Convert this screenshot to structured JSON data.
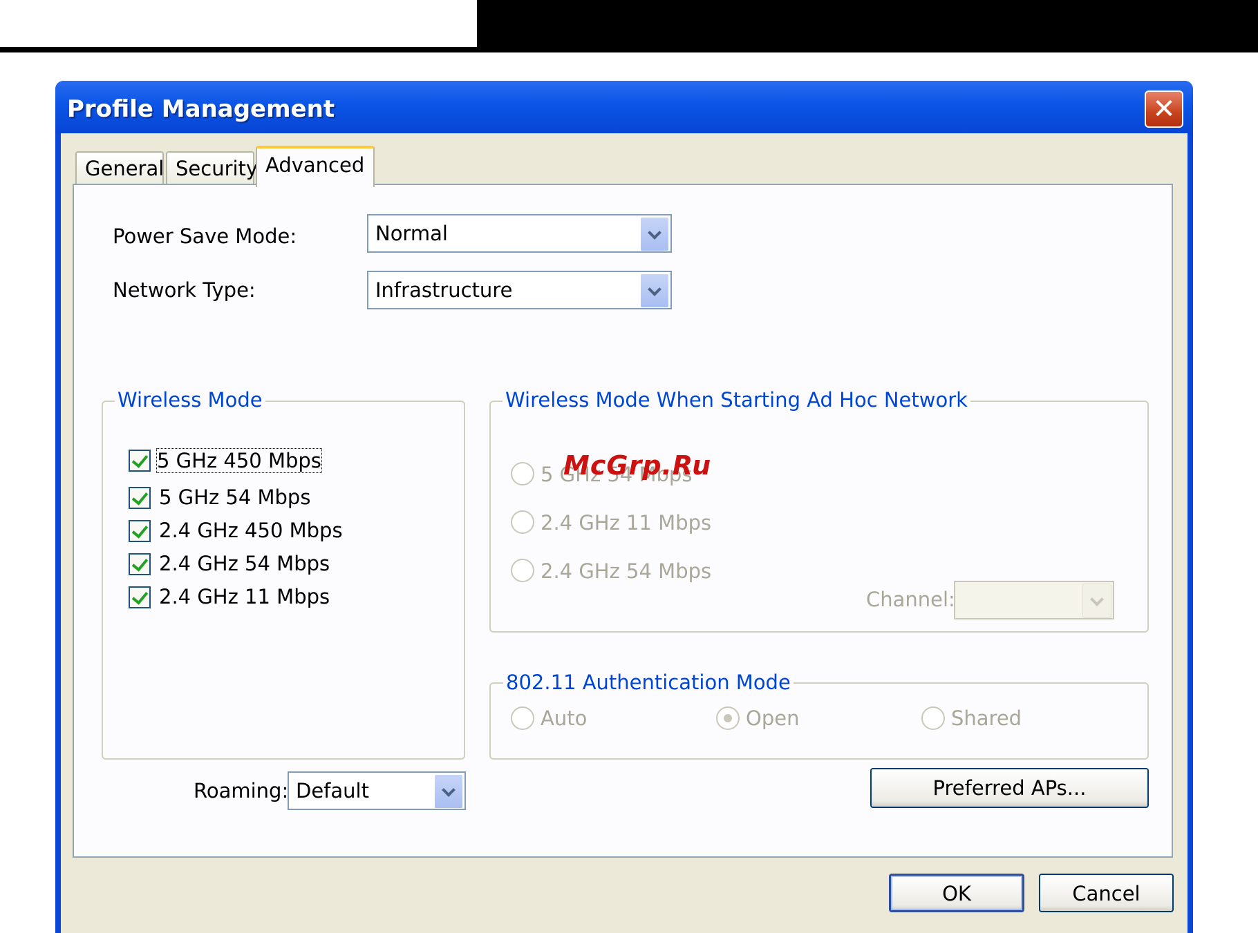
{
  "window": {
    "title": "Profile Management",
    "close_glyph": "✕"
  },
  "tabs": [
    {
      "label": "General",
      "active": false
    },
    {
      "label": "Security",
      "active": false
    },
    {
      "label": "Advanced",
      "active": true
    }
  ],
  "power_save_mode": {
    "label": "Power Save Mode:",
    "value": "Normal"
  },
  "network_type": {
    "label": "Network Type:",
    "value": "Infrastructure"
  },
  "wireless_mode": {
    "title": "Wireless Mode",
    "options": [
      {
        "label": "5 GHz 450 Mbps",
        "checked": true
      },
      {
        "label": "5 GHz 54 Mbps",
        "checked": true
      },
      {
        "label": "2.4 GHz 450 Mbps",
        "checked": true
      },
      {
        "label": "2.4 GHz 54 Mbps",
        "checked": true
      },
      {
        "label": "2.4 GHz 11 Mbps",
        "checked": true
      }
    ]
  },
  "adhoc_mode": {
    "title": "Wireless Mode When Starting Ad Hoc Network",
    "options": [
      {
        "label": "5 GHz 54 Mbps",
        "selected": false
      },
      {
        "label": "2.4 GHz 11 Mbps",
        "selected": false
      },
      {
        "label": "2.4 GHz 54 Mbps",
        "selected": false
      }
    ],
    "channel_label": "Channel:",
    "channel_value": ""
  },
  "auth_mode": {
    "title": "802.11 Authentication Mode",
    "options": [
      {
        "label": "Auto",
        "selected": false
      },
      {
        "label": "Open",
        "selected": true
      },
      {
        "label": "Shared",
        "selected": false
      }
    ]
  },
  "roaming": {
    "label": "Roaming:",
    "value": "Default"
  },
  "buttons": {
    "preferred_aps": "Preferred APs...",
    "ok": "OK",
    "cancel": "Cancel"
  },
  "watermark": "McGrp.Ru",
  "colors": {
    "titlebar": "#0845d4",
    "groupbox_title": "#0046d5",
    "dialog_face": "#ece9d8"
  }
}
